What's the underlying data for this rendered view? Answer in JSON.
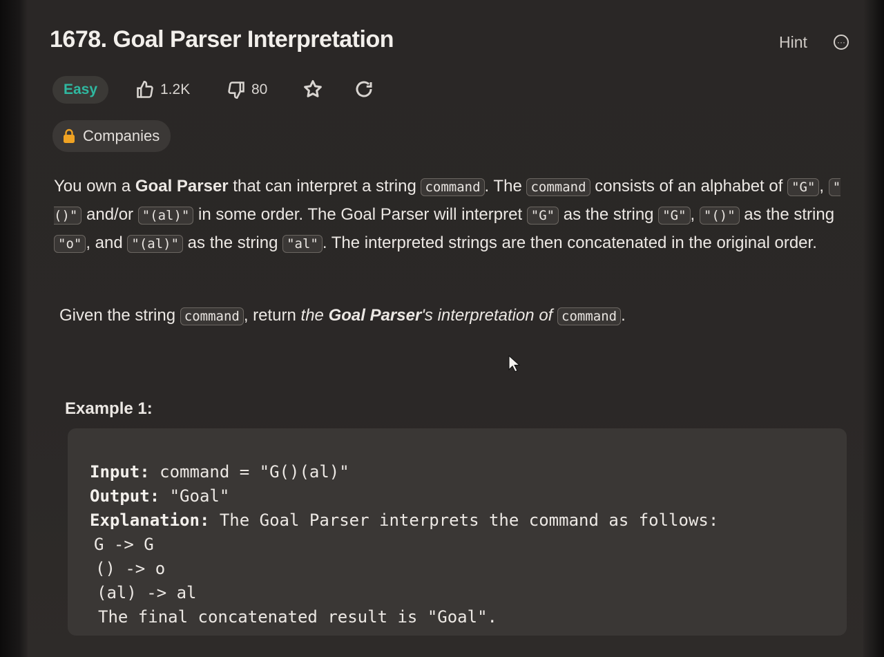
{
  "problem": {
    "title": "1678. Goal Parser Interpretation",
    "hint_label": "Hint",
    "difficulty": "Easy",
    "likes": "1.2K",
    "dislikes": "80",
    "companies_label": "Companies"
  },
  "description": {
    "p1": [
      {
        "t": "You own a "
      },
      {
        "t": "Goal Parser",
        "s": "bold"
      },
      {
        "t": " that can interpret a string "
      },
      {
        "t": "command",
        "s": "code"
      },
      {
        "t": ". The "
      },
      {
        "t": "command",
        "s": "code"
      },
      {
        "t": " consists of an alphabet of "
      },
      {
        "t": "\"G\"",
        "s": "code"
      },
      {
        "t": ", "
      },
      {
        "t": "\"()\"",
        "s": "code"
      },
      {
        "t": " and/or "
      },
      {
        "t": "\"(al)\"",
        "s": "code"
      },
      {
        "t": " in some order. The Goal Parser will interpret "
      },
      {
        "t": "\"G\"",
        "s": "code"
      },
      {
        "t": " as the string "
      },
      {
        "t": "\"G\"",
        "s": "code"
      },
      {
        "t": ", "
      },
      {
        "t": "\"()\"",
        "s": "code"
      },
      {
        "t": " as the string "
      },
      {
        "t": "\"o\"",
        "s": "code"
      },
      {
        "t": ", and "
      },
      {
        "t": "\"(al)\"",
        "s": "code"
      },
      {
        "t": " as the string "
      },
      {
        "t": "\"al\"",
        "s": "code"
      },
      {
        "t": ". The interpreted strings are then concatenated in the original order."
      }
    ],
    "p2": [
      {
        "t": "Given the string "
      },
      {
        "t": "command",
        "s": "code"
      },
      {
        "t": ", return "
      },
      {
        "t": "the ",
        "s": "italic"
      },
      {
        "t": "Goal Parser",
        "s": "bolditalic"
      },
      {
        "t": "'s interpretation of ",
        "s": "italic"
      },
      {
        "t": "command",
        "s": "code"
      },
      {
        "t": "."
      }
    ]
  },
  "example1": {
    "title": "Example 1:",
    "input_label": "Input:",
    "input_value": "command = \"G()(al)\"",
    "output_label": "Output:",
    "output_value": "\"Goal\"",
    "explanation_label": "Explanation:",
    "explanation_value": "The Goal Parser interprets the command as follows:",
    "lines": [
      "G -> G",
      "() -> o",
      "(al) -> al",
      "The final concatenated result is \"Goal\"."
    ]
  },
  "colors": {
    "easy": "#2fb8a0",
    "background": "#2a2726",
    "code_bg": "#3a3735"
  },
  "icons": {
    "like": "thumbs-up-icon",
    "dislike": "thumbs-down-icon",
    "favorite": "star-icon",
    "share": "refresh-icon",
    "lock": "lock-icon",
    "more": "more-icon"
  }
}
